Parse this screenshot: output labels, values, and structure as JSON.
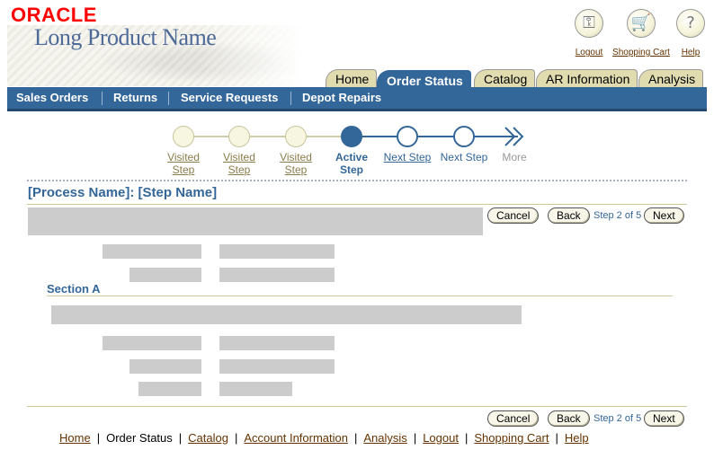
{
  "branding": {
    "logo": "ORACLE",
    "product": "Long Product Name"
  },
  "global_buttons": [
    {
      "label": "Logout",
      "icon": "key-icon",
      "glyph": "⚿"
    },
    {
      "label": "Shopping Cart",
      "icon": "cart-icon",
      "glyph": "🛒"
    },
    {
      "label": "Help",
      "icon": "help-icon",
      "glyph": "?"
    }
  ],
  "tabs": [
    "Home",
    "Order Status",
    "Catalog",
    "AR Information",
    "Analysis"
  ],
  "active_tab": "Order Status",
  "subnav": [
    "Sales Orders",
    "Returns",
    "Service Requests",
    "Depot Repairs"
  ],
  "train": {
    "steps": [
      {
        "line1": "Visited",
        "line2": "Step",
        "state": "visited"
      },
      {
        "line1": "Visited",
        "line2": "Step",
        "state": "visited"
      },
      {
        "line1": "Visited",
        "line2": "Step",
        "state": "visited"
      },
      {
        "line1": "Active",
        "line2": "Step",
        "state": "active"
      },
      {
        "line1": "Next Step",
        "line2": "",
        "state": "next-link"
      },
      {
        "line1": "Next Step",
        "line2": "",
        "state": "next"
      }
    ],
    "more_label": "More"
  },
  "page": {
    "title": "[Process Name]: [Step Name]",
    "section_title": "Section A"
  },
  "buttons": {
    "cancel": "Cancel",
    "back": "Back",
    "next": "Next",
    "step_info": "Step 2 of 5"
  },
  "footer": {
    "links": [
      "Home",
      "Order Status",
      "Catalog",
      "Account Information",
      "Analysis",
      "Logout",
      "Shopping Cart",
      "Help"
    ],
    "current": "Order Status"
  },
  "colors": {
    "accent": "#336699",
    "tab_inactive": "#e0dcaf",
    "logo_red": "#ff0000",
    "link_brown": "#663300"
  }
}
